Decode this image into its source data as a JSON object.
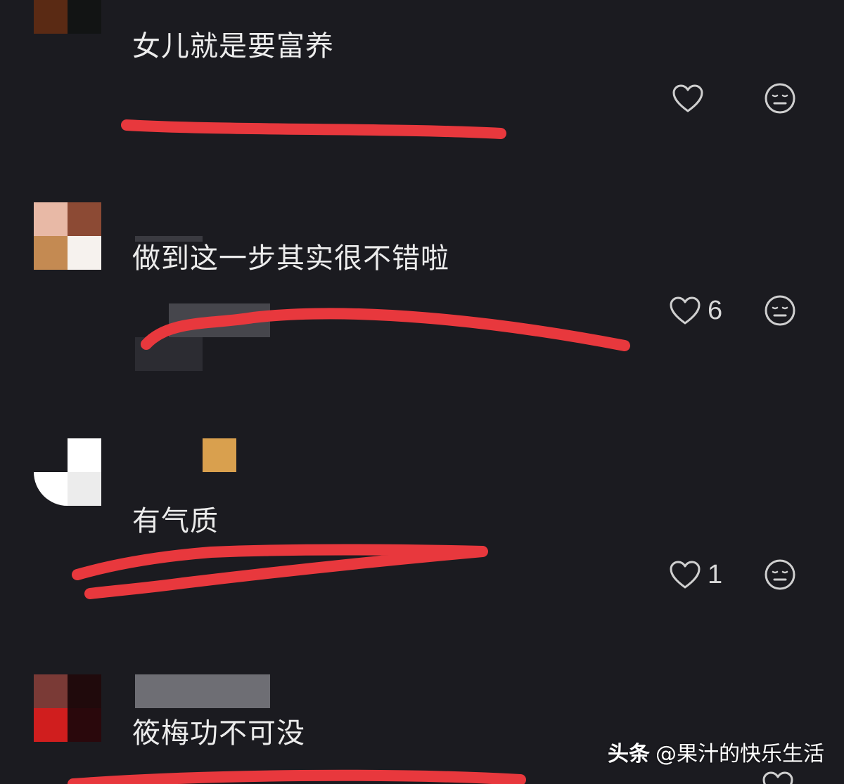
{
  "comments": [
    {
      "text": "女儿就是要富养",
      "likes": ""
    },
    {
      "text": "做到这一步其实很不错啦",
      "likes": "6"
    },
    {
      "text": "有气质",
      "likes": "1"
    },
    {
      "text": "筱梅功不可没",
      "likes": ""
    }
  ],
  "icons": {
    "like": "heart-outline-icon",
    "react": "neutral-face-icon"
  },
  "colors": {
    "background": "#1b1b20",
    "text": "#ececec",
    "annotation": "#e8383d"
  },
  "watermark": {
    "brand": "头条",
    "author": "@果汁的快乐生活"
  }
}
